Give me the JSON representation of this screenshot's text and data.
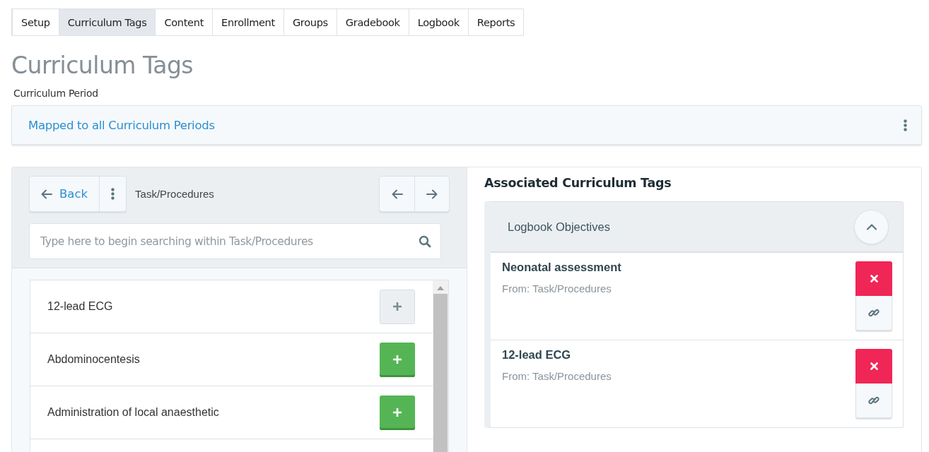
{
  "tabs": [
    {
      "label": "Setup",
      "selected": false
    },
    {
      "label": "Curriculum Tags",
      "selected": true
    },
    {
      "label": "Content",
      "selected": false
    },
    {
      "label": "Enrollment",
      "selected": false
    },
    {
      "label": "Groups",
      "selected": false
    },
    {
      "label": "Gradebook",
      "selected": false
    },
    {
      "label": "Logbook",
      "selected": false
    },
    {
      "label": "Reports",
      "selected": false
    }
  ],
  "page_title": "Curriculum Tags",
  "curriculum_period": {
    "label": "Curriculum Period",
    "value": "Mapped to all Curriculum Periods"
  },
  "browser": {
    "back_label": "Back",
    "breadcrumb": "Task/Procedures",
    "search": {
      "placeholder": "Type here to begin searching within Task/Procedures"
    },
    "items": [
      {
        "name": "12-lead ECG",
        "added": true
      },
      {
        "name": "Abdominocentesis",
        "added": false
      },
      {
        "name": "Administration of local anaesthetic",
        "added": false
      }
    ]
  },
  "associated": {
    "title": "Associated Curriculum Tags",
    "section": {
      "title": "Logbook Objectives",
      "expanded": true,
      "items": [
        {
          "name": "Neonatal assessment",
          "source": "From: Task/Procedures"
        },
        {
          "name": "12-lead ECG",
          "source": "From: Task/Procedures"
        }
      ]
    }
  }
}
